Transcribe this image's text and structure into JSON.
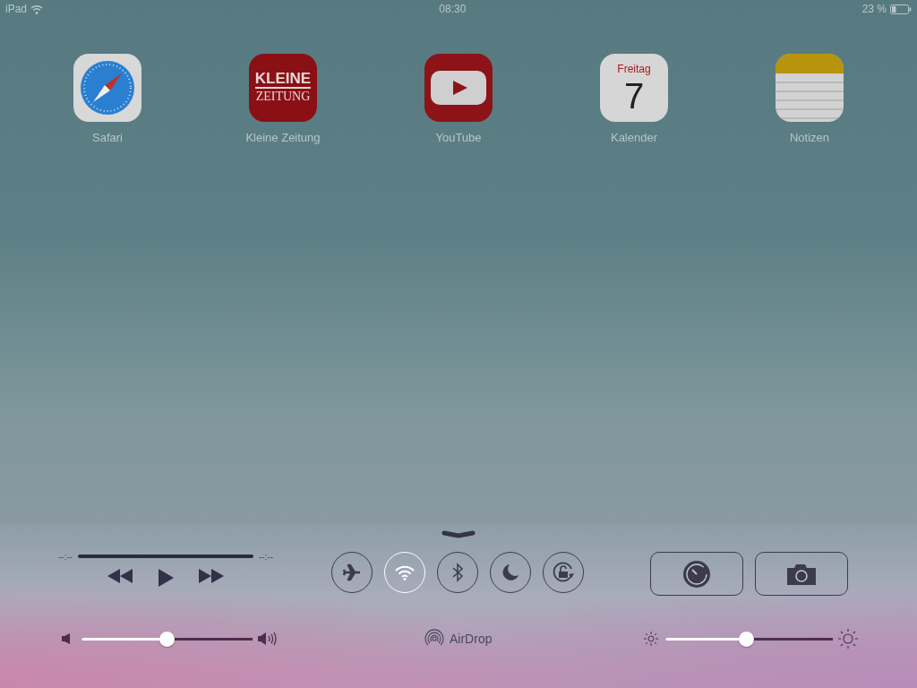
{
  "status_bar": {
    "device": "iPad",
    "time": "08:30",
    "battery": "23 %"
  },
  "apps": [
    {
      "kind": "safari",
      "label": "Safari"
    },
    {
      "kind": "newspaper",
      "label": "Kleine Zeitung",
      "logo_lines": [
        "KLEINE",
        "ZEITUNG"
      ]
    },
    {
      "kind": "video",
      "label": "YouTube"
    },
    {
      "kind": "calendar",
      "label": "Kalender",
      "weekday": "Freitag",
      "date": "7"
    },
    {
      "kind": "notes",
      "label": "Notizen"
    }
  ],
  "control_center": {
    "media": {
      "elapsed": "--:--",
      "remaining": "--:--"
    },
    "toggles": [
      {
        "kind": "airplane",
        "on": false
      },
      {
        "kind": "wifi",
        "on": true
      },
      {
        "kind": "bluetooth",
        "on": false
      },
      {
        "kind": "moon",
        "on": false
      },
      {
        "kind": "rotation-lock",
        "on": false
      }
    ],
    "shortcuts": [
      {
        "kind": "timer"
      },
      {
        "kind": "camera"
      }
    ],
    "volume": {
      "level": 0.5
    },
    "airdrop": {
      "label": "AirDrop"
    },
    "brightness": {
      "level": 0.48
    }
  }
}
